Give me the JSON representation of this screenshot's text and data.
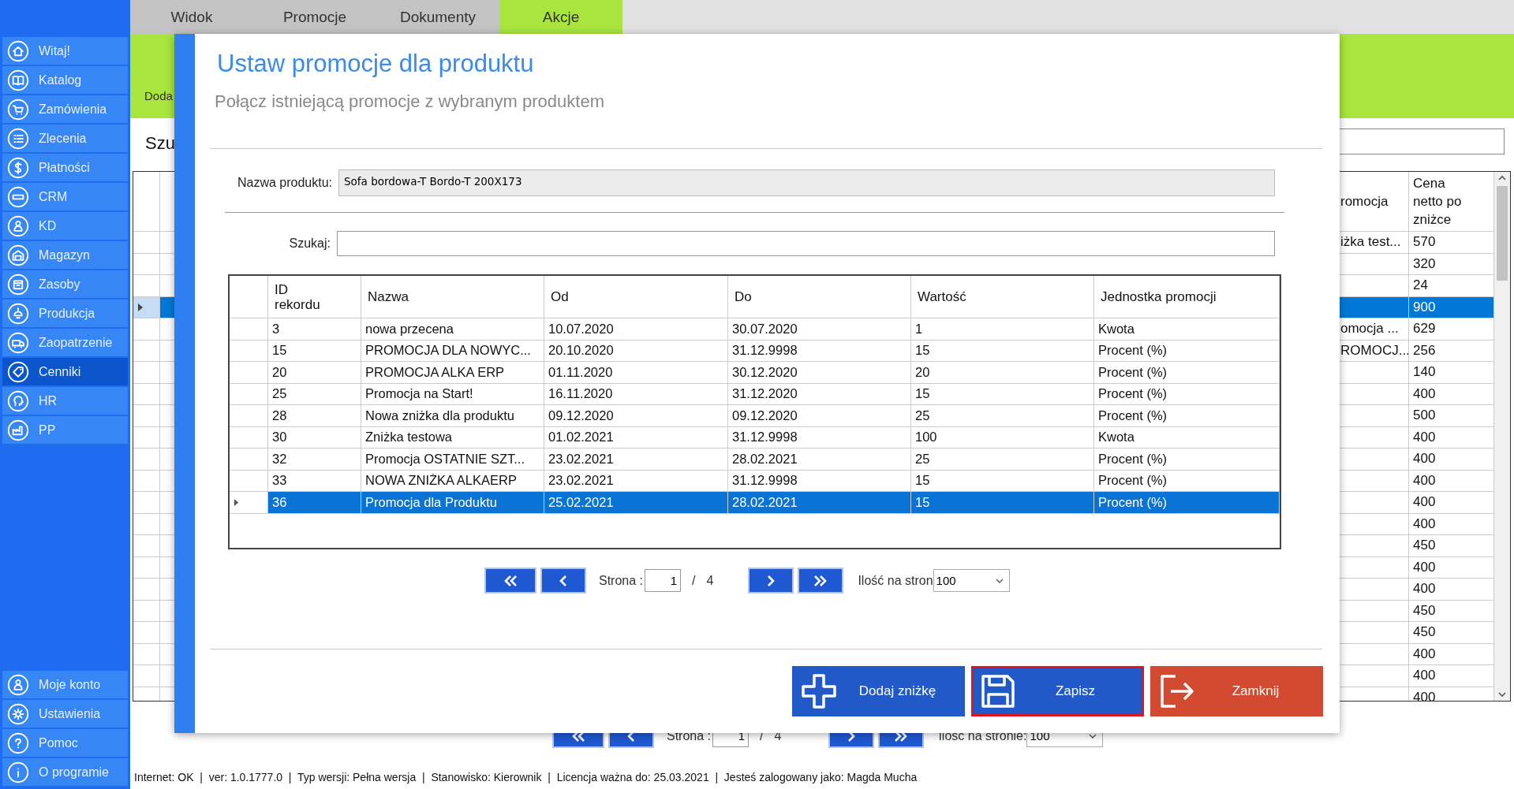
{
  "tabs": [
    {
      "label": "Widok",
      "selected": false
    },
    {
      "label": "Promocje",
      "selected": false
    },
    {
      "label": "Dokumenty",
      "selected": false
    },
    {
      "label": "Akcje",
      "selected": true
    }
  ],
  "sidebar": {
    "items": [
      {
        "label": "Witaj!",
        "selected": false
      },
      {
        "label": "Katalog",
        "selected": false
      },
      {
        "label": "Zamówienia",
        "selected": false
      },
      {
        "label": "Zlecenia",
        "selected": false
      },
      {
        "label": "Płatności",
        "selected": false
      },
      {
        "label": "CRM",
        "selected": false
      },
      {
        "label": "KD",
        "selected": false
      },
      {
        "label": "Magazyn",
        "selected": false
      },
      {
        "label": "Zasoby",
        "selected": false
      },
      {
        "label": "Produkcja",
        "selected": false
      },
      {
        "label": "Zaopatrzenie",
        "selected": false
      },
      {
        "label": "Cenniki",
        "selected": true
      },
      {
        "label": "HR",
        "selected": false
      },
      {
        "label": "PP",
        "selected": false
      }
    ],
    "bottom_items": [
      {
        "label": "Moje konto",
        "selected": false
      },
      {
        "label": "Ustawienia",
        "selected": false
      },
      {
        "label": "Pomoc",
        "selected": false
      },
      {
        "label": "O programie",
        "selected": false
      }
    ]
  },
  "toolbar": {
    "button_label": "Doda"
  },
  "search_label": "Szu",
  "background_table": {
    "columns": [
      "romocja",
      "Cena netto po zniżce"
    ],
    "rows": [
      {
        "column_1": "iżka test...",
        "price": "570",
        "selected": false
      },
      {
        "price": "320",
        "selected": false
      },
      {
        "price": "24",
        "selected": false
      },
      {
        "price": "900",
        "selected": true
      },
      {
        "column_1": "omocja ...",
        "price": "629",
        "selected": false
      },
      {
        "column_1": "ROMOCJ...",
        "price": "256",
        "selected": false
      },
      {
        "price": "140",
        "selected": false
      },
      {
        "price": "400",
        "selected": false
      },
      {
        "price": "500",
        "selected": false
      },
      {
        "price": "400",
        "selected": false
      },
      {
        "price": "400",
        "selected": false
      },
      {
        "price": "400",
        "selected": false
      },
      {
        "price": "400",
        "selected": false
      },
      {
        "price": "400",
        "selected": false
      },
      {
        "price": "450",
        "selected": false
      },
      {
        "price": "400",
        "selected": false
      },
      {
        "price": "400",
        "selected": false
      },
      {
        "price": "450",
        "selected": false
      },
      {
        "price": "450",
        "selected": false
      },
      {
        "price": "400",
        "selected": false
      },
      {
        "price": "400",
        "selected": false
      },
      {
        "price": "400",
        "selected": false
      }
    ]
  },
  "background_pager": {
    "page_label": "Strona :",
    "page": "1",
    "separator": "/",
    "total": "4",
    "per_page_label": "Ilość na stronie:",
    "per_page": "100"
  },
  "dialog": {
    "title": "Ustaw promocje dla produktu",
    "subtitle": "Połącz istniejącą promocje z wybranym produktem",
    "product_label": "Nazwa produktu:",
    "product_value": "Sofa bordowa-T Bordo-T 200X173",
    "search_label": "Szukaj:",
    "table": {
      "columns": [
        "ID rekordu",
        "Nazwa",
        "Od",
        "Do",
        "Wartość",
        "Jednostka promocji"
      ],
      "rows": [
        {
          "cells": [
            "3",
            "nowa przecena",
            "10.07.2020",
            "30.07.2020",
            "1",
            "Kwota"
          ],
          "selected": false
        },
        {
          "cells": [
            "15",
            "PROMOCJA DLA NOWYC...",
            "20.10.2020",
            "31.12.9998",
            "15",
            "Procent (%)"
          ],
          "selected": false
        },
        {
          "cells": [
            "20",
            "PROMOCJA ALKA ERP",
            "01.11.2020",
            "30.12.2020",
            "20",
            "Procent (%)"
          ],
          "selected": false
        },
        {
          "cells": [
            "25",
            "Promocja na Start!",
            "16.11.2020",
            "31.12.2020",
            "15",
            "Procent (%)"
          ],
          "selected": false
        },
        {
          "cells": [
            "28",
            "Nowa zniżka dla produktu",
            "09.12.2020",
            "09.12.2020",
            "25",
            "Procent (%)"
          ],
          "selected": false
        },
        {
          "cells": [
            "30",
            "Zniżka testowa",
            "01.02.2021",
            "31.12.9998",
            "100",
            "Kwota"
          ],
          "selected": false
        },
        {
          "cells": [
            "32",
            "Promocja OSTATNIE SZT...",
            "23.02.2021",
            "28.02.2021",
            "25",
            "Procent (%)"
          ],
          "selected": false
        },
        {
          "cells": [
            "33",
            "NOWA ZNIŻKA ALKAERP",
            "23.02.2021",
            "31.12.9998",
            "15",
            "Procent (%)"
          ],
          "selected": false
        },
        {
          "cells": [
            "36",
            "Promocja dla Produktu",
            "25.02.2021",
            "28.02.2021",
            "15",
            "Procent (%)"
          ],
          "selected": true
        }
      ]
    },
    "pager": {
      "page_label": "Strona :",
      "page": "1",
      "separator": "/",
      "total": "4",
      "per_page_label": "Ilość na stron",
      "per_page": "100"
    },
    "buttons": [
      {
        "label": "Dodaj zniżkę",
        "kind": "add",
        "focused": false
      },
      {
        "label": "Zapisz",
        "kind": "save",
        "focused": true
      },
      {
        "label": "Zamknij",
        "kind": "close",
        "focused": false
      }
    ]
  },
  "status_bar": "Internet: OK  |  ver: 1.0.1777.0  |  Typ wersji: Pełna wersja  |  Stanowisko: Kierownik  |  Licencja ważna do: 25.03.2021  |  Jesteś zalogowany jako: Magda Mucha"
}
